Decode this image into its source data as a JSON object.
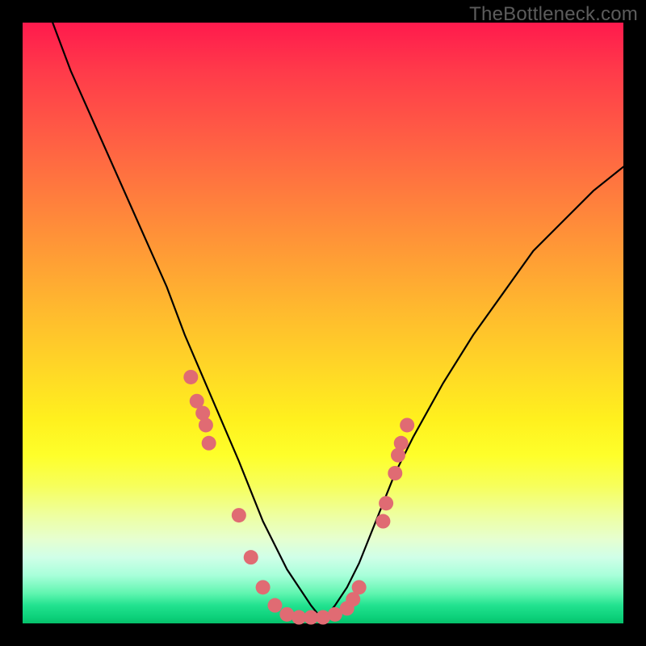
{
  "watermark": "TheBottleneck.com",
  "chart_data": {
    "type": "line",
    "title": "",
    "xlabel": "",
    "ylabel": "",
    "xlim": [
      0,
      100
    ],
    "ylim": [
      0,
      100
    ],
    "grid": false,
    "legend": false,
    "series": [
      {
        "name": "left-curve",
        "x": [
          5,
          8,
          12,
          16,
          20,
          24,
          27,
          30,
          33,
          36,
          38,
          40,
          42,
          44,
          46,
          48,
          50
        ],
        "values": [
          100,
          92,
          83,
          74,
          65,
          56,
          48,
          41,
          34,
          27,
          22,
          17,
          13,
          9,
          6,
          3,
          0.5
        ]
      },
      {
        "name": "right-curve",
        "x": [
          50,
          52,
          54,
          56,
          58,
          60,
          62,
          65,
          70,
          75,
          80,
          85,
          90,
          95,
          100
        ],
        "values": [
          0.5,
          3,
          6,
          10,
          15,
          20,
          25,
          31,
          40,
          48,
          55,
          62,
          67,
          72,
          76
        ]
      }
    ],
    "markers": {
      "name": "scatter-points",
      "color": "#e06b73",
      "points": [
        {
          "x": 28,
          "y": 41
        },
        {
          "x": 29,
          "y": 37
        },
        {
          "x": 30,
          "y": 35
        },
        {
          "x": 30.5,
          "y": 33
        },
        {
          "x": 31,
          "y": 30
        },
        {
          "x": 36,
          "y": 18
        },
        {
          "x": 38,
          "y": 11
        },
        {
          "x": 40,
          "y": 6
        },
        {
          "x": 42,
          "y": 3
        },
        {
          "x": 44,
          "y": 1.5
        },
        {
          "x": 46,
          "y": 1
        },
        {
          "x": 48,
          "y": 1
        },
        {
          "x": 50,
          "y": 1
        },
        {
          "x": 52,
          "y": 1.5
        },
        {
          "x": 54,
          "y": 2.5
        },
        {
          "x": 55,
          "y": 4
        },
        {
          "x": 56,
          "y": 6
        },
        {
          "x": 60,
          "y": 17
        },
        {
          "x": 60.5,
          "y": 20
        },
        {
          "x": 62,
          "y": 25
        },
        {
          "x": 62.5,
          "y": 28
        },
        {
          "x": 63,
          "y": 30
        },
        {
          "x": 64,
          "y": 33
        }
      ]
    }
  }
}
